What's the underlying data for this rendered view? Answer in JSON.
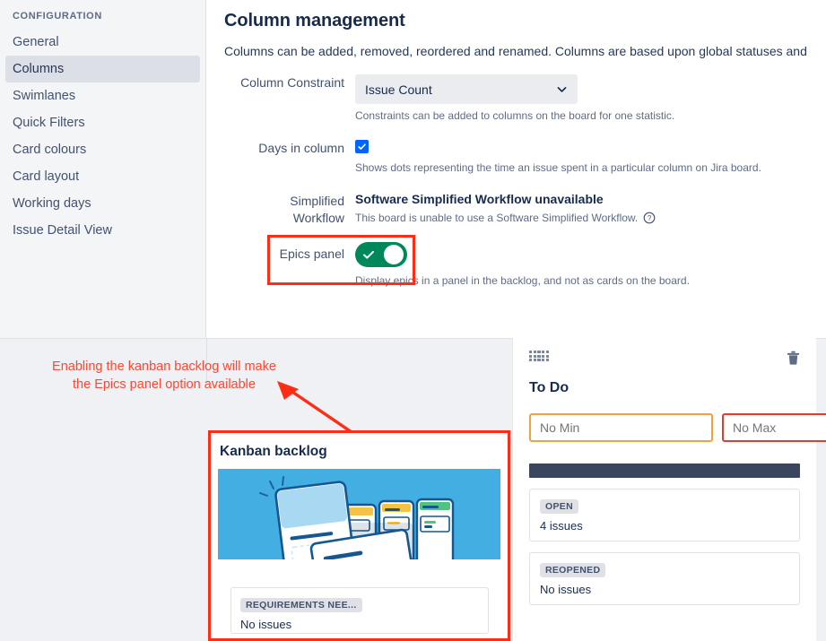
{
  "sidebar": {
    "heading": "CONFIGURATION",
    "items": [
      {
        "label": "General",
        "active": false
      },
      {
        "label": "Columns",
        "active": true
      },
      {
        "label": "Swimlanes",
        "active": false
      },
      {
        "label": "Quick Filters",
        "active": false
      },
      {
        "label": "Card colours",
        "active": false
      },
      {
        "label": "Card layout",
        "active": false
      },
      {
        "label": "Working days",
        "active": false
      },
      {
        "label": "Issue Detail View",
        "active": false
      }
    ]
  },
  "main": {
    "title": "Column management",
    "description": "Columns can be added, removed, reordered and renamed. Columns are based upon global statuses and",
    "column_constraint": {
      "label": "Column Constraint",
      "value": "Issue Count",
      "help": "Constraints can be added to columns on the board for one statistic.",
      "chevron_icon": "chevron-down-icon"
    },
    "days_in_column": {
      "label": "Days in column",
      "checked": true,
      "help": "Shows dots representing the time an issue spent in a particular column on Jira board.",
      "check_icon": "check-icon"
    },
    "simplified_workflow": {
      "label_line1": "Simplified",
      "label_line2": "Workflow",
      "title": "Software Simplified Workflow unavailable",
      "sub": "This board is unable to use a Software Simplified Workflow.",
      "help_icon": "question-circle-icon"
    },
    "epics_panel": {
      "label": "Epics panel",
      "enabled": true,
      "help": "Display epics in a panel in the backlog, and not as cards on the board.",
      "toggle_icon": "check-icon",
      "highlight_color": "#ff2d16"
    }
  },
  "annotation": {
    "line1": "Enabling the kanban backlog will make",
    "line2": "the Epics panel option available",
    "color": "#ff4632",
    "arrow_icon": "arrow-pointer-icon"
  },
  "kanban_card": {
    "title": "Kanban backlog",
    "illustration_icon": "kanban-board-illustration",
    "illustration_bg": "#42aee2",
    "highlight_color": "#ff2d16",
    "issue": {
      "badge": "REQUIREMENTS NEE...",
      "count": "No issues"
    }
  },
  "todo_panel": {
    "drag_handle_icon": "drag-handle-icon",
    "delete_icon": "trash-icon",
    "title": "To Do",
    "min": {
      "placeholder": "No Min",
      "value": "",
      "border_color": "#f0a33a"
    },
    "max": {
      "placeholder": "No Max",
      "value": "",
      "border_color": "#e8392a"
    },
    "capacity_bar_color": "#39465e",
    "statuses": [
      {
        "badge": "OPEN",
        "count": "4 issues"
      },
      {
        "badge": "REOPENED",
        "count": "No issues"
      }
    ]
  }
}
